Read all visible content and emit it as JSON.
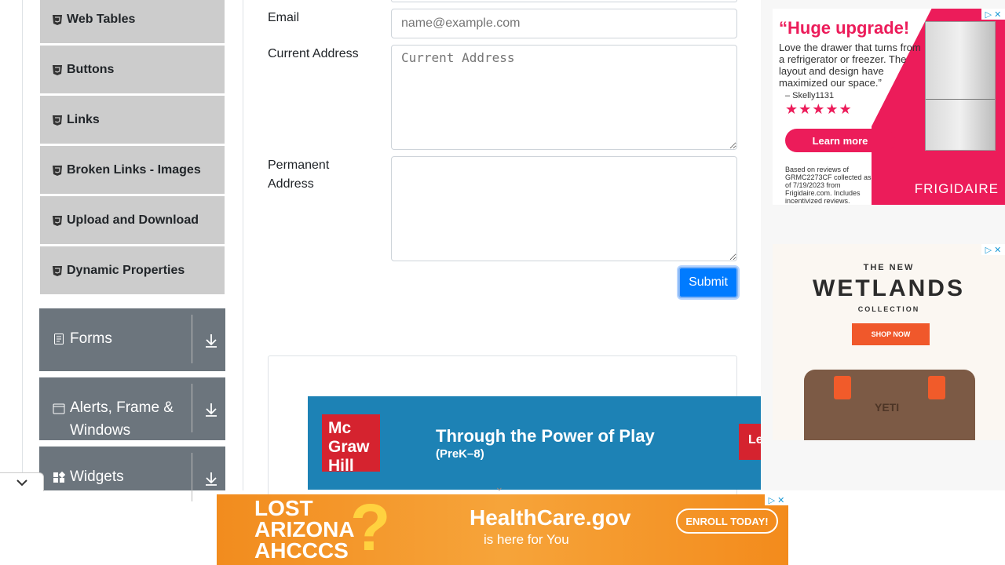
{
  "sidebar": {
    "items": [
      {
        "label": "Web Tables",
        "icon": "html5-icon"
      },
      {
        "label": "Buttons",
        "icon": "html5-icon"
      },
      {
        "label": "Links",
        "icon": "html5-icon"
      },
      {
        "label": "Broken Links - Images",
        "icon": "html5-icon"
      },
      {
        "label": "Upload and Download",
        "icon": "html5-icon"
      },
      {
        "label": "Dynamic Properties",
        "icon": "html5-icon"
      }
    ],
    "groups": [
      {
        "label": "Forms",
        "icon": "document-icon"
      },
      {
        "label": "Alerts, Frame & Windows",
        "label_line1": "Alerts, Frame &",
        "label_line2": "Windows",
        "icon": "window-icon"
      },
      {
        "label": "Widgets",
        "icon": "widgets-icon"
      }
    ]
  },
  "form": {
    "email_label": "Email",
    "email_placeholder": "name@example.com",
    "current_address_label": "Current Address",
    "current_address_placeholder": "Current Address",
    "permanent_address_label_line1": "Permanent",
    "permanent_address_label_line2": "Address",
    "submit_label": "Submit"
  },
  "ads": {
    "mcgraw": {
      "logo": "Mc Graw Hill",
      "title": "Through the Power of Play",
      "subtitle": "(PreK–8)",
      "cta": "Le"
    },
    "frigidaire": {
      "title": "“Huge upgrade!",
      "quote": "Love the drawer that turns from a refrigerator or freezer. The layout and design have maximized our space.”",
      "author": "– Skelly1131",
      "stars": "★★★★★",
      "cta": "Learn more",
      "fine_print": "Based on reviews of GRMC2273CF collected as of 7/19/2023 from Frigidaire.com. Includes incentivized reviews.",
      "brand": "FRIGIDAIRE"
    },
    "yeti": {
      "line1": "THE NEW",
      "title": "WETLANDS",
      "line2": "COLLECTION",
      "cta": "SHOP NOW",
      "brand": "YETI"
    },
    "healthcare": {
      "left": "LOST\nARIZONA\nAHCCCS",
      "left_1": "LOST",
      "left_2": "ARIZONA",
      "left_3": "AHCCCS",
      "qm": "?",
      "title": "HealthCare.gov",
      "subtitle": "is here for You",
      "cta": "ENROLL TODAY!"
    }
  }
}
